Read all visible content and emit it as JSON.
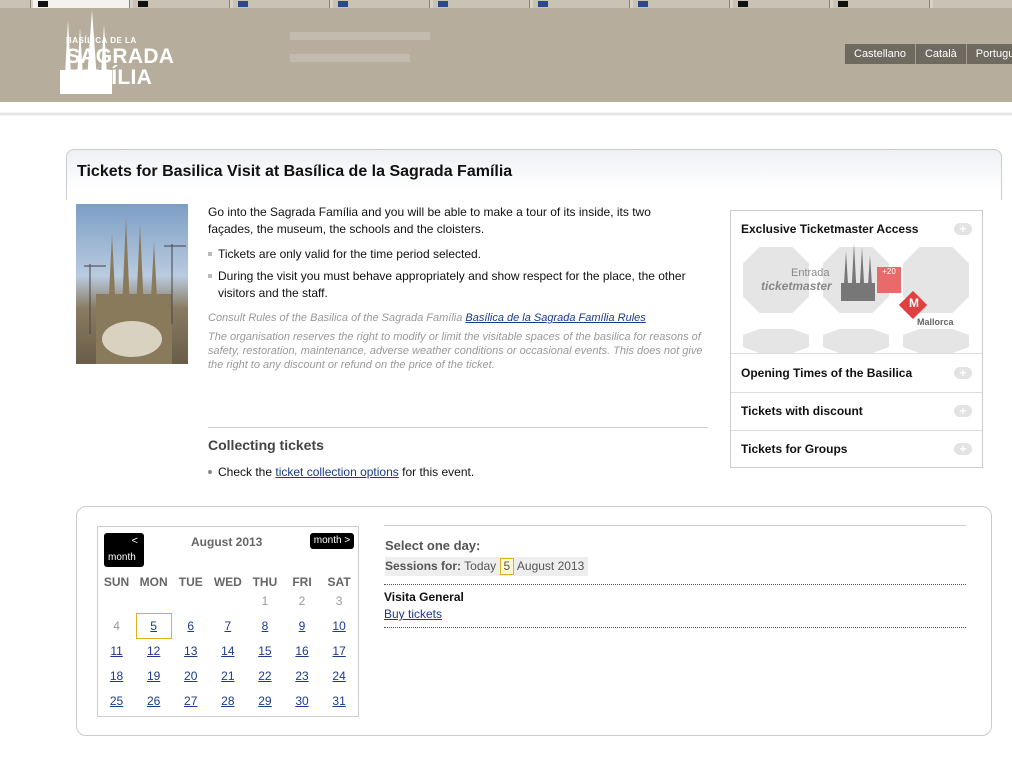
{
  "header": {
    "logo_small": "BASÍLICA DE LA",
    "logo_line1": "SAGRADA",
    "logo_line2": "FAMÍLIA",
    "languages": [
      "Castellano",
      "Català",
      "Portugu"
    ]
  },
  "page": {
    "title": "Tickets for Basilica Visit at Basílica de la Sagrada Família",
    "intro": "Go into the Sagrada Família and you will be able to make a tour of its inside, its two façades, the museum, the schools and the cloisters.",
    "bullets": [
      "Tickets are only valid for the time period selected.",
      "During the visit you must behave appropriately and show respect for the place, the other visitors and the staff."
    ],
    "consult_text": "Consult Rules of the Basilica of the Sagrada Família",
    "consult_link": "Basílica de la Sagrada Família Rules",
    "disclaimer": "The organisation reserves the right to modify or limit the visitable spaces of the basilica for reasons of safety, restoration, maintenance, adverse weather conditions or occasional events. This does not give the right to any discount or refund on the price of the ticket.",
    "collecting_heading": "Collecting tickets",
    "collect_pre": "Check the",
    "collect_link": "ticket collection options",
    "collect_post": "for this event."
  },
  "sidebar": {
    "items": [
      {
        "label": "Exclusive Ticketmaster Access"
      },
      {
        "label": "Opening Times of the Basilica"
      },
      {
        "label": "Tickets with discount"
      },
      {
        "label": "Tickets for Groups"
      }
    ],
    "promo_entrada": "Entrada",
    "promo_ticketmaster": "ticketmaster",
    "promo_mallorca": "Mallorca",
    "promo_badge": "+20"
  },
  "calendar": {
    "prev_label": "<",
    "prev_sub": "month",
    "next_label": "month >",
    "month_title": "August 2013",
    "weekdays": [
      "SUN",
      "MON",
      "TUE",
      "WED",
      "THU",
      "FRI",
      "SAT"
    ],
    "weeks": [
      [
        "",
        "",
        "",
        "",
        "1",
        "2",
        "3"
      ],
      [
        "4",
        "5",
        "6",
        "7",
        "8",
        "9",
        "10"
      ],
      [
        "11",
        "12",
        "13",
        "14",
        "15",
        "16",
        "17"
      ],
      [
        "18",
        "19",
        "20",
        "21",
        "22",
        "23",
        "24"
      ],
      [
        "25",
        "26",
        "27",
        "28",
        "29",
        "30",
        "31"
      ]
    ],
    "selected_day": "5"
  },
  "sessions": {
    "heading": "Select one day:",
    "label": "Sessions for:",
    "today": "Today",
    "day": "5",
    "month_year": "August 2013",
    "event_name": "Visita General",
    "buy_label": "Buy tickets"
  }
}
